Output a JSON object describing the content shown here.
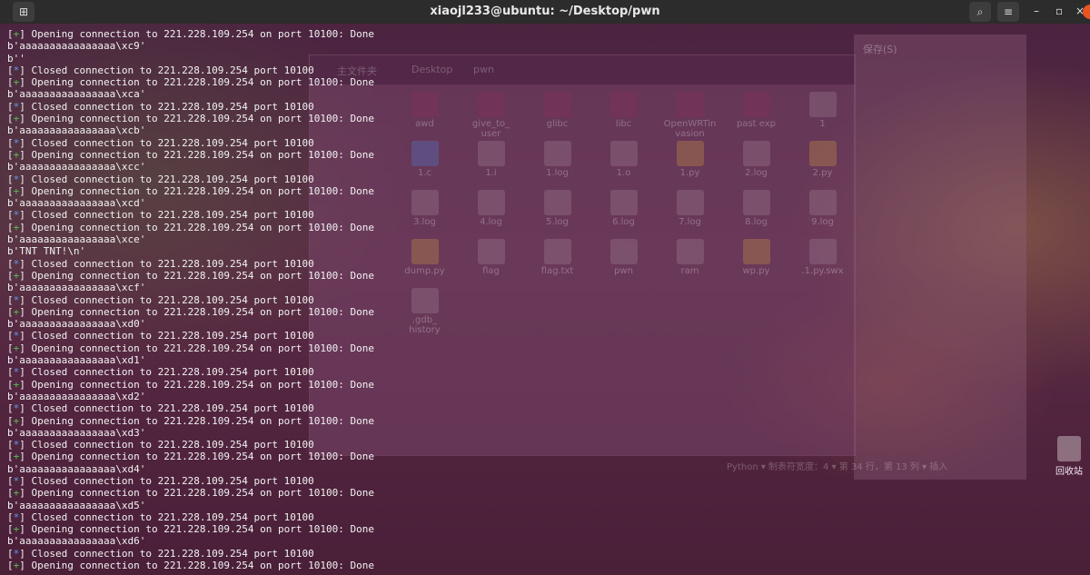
{
  "titlebar": {
    "title": "xiaojl233@ubuntu: ~/Desktop/pwn",
    "new_tab_icon": "new-tab-icon",
    "search_icon": "search-icon",
    "menu_icon": "hamburger-menu-icon",
    "minimize_label": "–",
    "maximize_label": "▫",
    "close_label": "×"
  },
  "file_manager": {
    "crumbs": [
      "主文件夹",
      "Desktop",
      "pwn"
    ],
    "items": [
      {
        "label": "awd",
        "kind": "folder"
      },
      {
        "label": "give_to_\nuser",
        "kind": "folder"
      },
      {
        "label": "glibc",
        "kind": "folder"
      },
      {
        "label": "libc",
        "kind": "folder"
      },
      {
        "label": "OpenWRTin\nvasion",
        "kind": "folder"
      },
      {
        "label": "past exp",
        "kind": "folder"
      },
      {
        "label": "1",
        "kind": "file"
      },
      {
        "label": "1.c",
        "kind": "c"
      },
      {
        "label": "1.i",
        "kind": "file"
      },
      {
        "label": "1.log",
        "kind": "file"
      },
      {
        "label": "1.o",
        "kind": "file"
      },
      {
        "label": "1.py",
        "kind": "py"
      },
      {
        "label": "2.log",
        "kind": "file"
      },
      {
        "label": "2.py",
        "kind": "py"
      },
      {
        "label": "3.log",
        "kind": "file"
      },
      {
        "label": "4.log",
        "kind": "file"
      },
      {
        "label": "5.log",
        "kind": "file"
      },
      {
        "label": "6.log",
        "kind": "file"
      },
      {
        "label": "7.log",
        "kind": "file"
      },
      {
        "label": "8.log",
        "kind": "file"
      },
      {
        "label": "9.log",
        "kind": "file"
      },
      {
        "label": "dump.py",
        "kind": "py"
      },
      {
        "label": "flag",
        "kind": "file"
      },
      {
        "label": "flag.txt",
        "kind": "file"
      },
      {
        "label": "pwn",
        "kind": "file"
      },
      {
        "label": "ram",
        "kind": "file"
      },
      {
        "label": "wp.py",
        "kind": "py"
      },
      {
        "label": ".1.py.swx",
        "kind": "file"
      },
      {
        "label": ".gdb_\nhistory",
        "kind": "file"
      }
    ]
  },
  "editor": {
    "title": "1.py",
    "save_label": "保存(S)",
    "status": "Python ▾   制表符宽度：4 ▾   第 34 行，第 13 列 ▾   插入"
  },
  "desktop": {
    "trash_label": "回收站"
  },
  "terminal": {
    "lines": [
      {
        "mark": "+",
        "text": "Opening connection to 221.228.109.254 on port 10100: Done"
      },
      {
        "mark": "",
        "text": "b'aaaaaaaaaaaaaaaa\\xc9'"
      },
      {
        "mark": "",
        "text": "b''"
      },
      {
        "mark": "*",
        "text": "Closed connection to 221.228.109.254 port 10100"
      },
      {
        "mark": "+",
        "text": "Opening connection to 221.228.109.254 on port 10100: Done"
      },
      {
        "mark": "",
        "text": "b'aaaaaaaaaaaaaaaa\\xca'"
      },
      {
        "mark": "*",
        "text": "Closed connection to 221.228.109.254 port 10100"
      },
      {
        "mark": "+",
        "text": "Opening connection to 221.228.109.254 on port 10100: Done"
      },
      {
        "mark": "",
        "text": "b'aaaaaaaaaaaaaaaa\\xcb'"
      },
      {
        "mark": "*",
        "text": "Closed connection to 221.228.109.254 port 10100"
      },
      {
        "mark": "+",
        "text": "Opening connection to 221.228.109.254 on port 10100: Done"
      },
      {
        "mark": "",
        "text": "b'aaaaaaaaaaaaaaaa\\xcc'"
      },
      {
        "mark": "*",
        "text": "Closed connection to 221.228.109.254 port 10100"
      },
      {
        "mark": "+",
        "text": "Opening connection to 221.228.109.254 on port 10100: Done"
      },
      {
        "mark": "",
        "text": "b'aaaaaaaaaaaaaaaa\\xcd'"
      },
      {
        "mark": "*",
        "text": "Closed connection to 221.228.109.254 port 10100"
      },
      {
        "mark": "+",
        "text": "Opening connection to 221.228.109.254 on port 10100: Done"
      },
      {
        "mark": "",
        "text": "b'aaaaaaaaaaaaaaaa\\xce'"
      },
      {
        "mark": "",
        "text": "b'TNT TNT!\\n'"
      },
      {
        "mark": "*",
        "text": "Closed connection to 221.228.109.254 port 10100"
      },
      {
        "mark": "+",
        "text": "Opening connection to 221.228.109.254 on port 10100: Done"
      },
      {
        "mark": "",
        "text": "b'aaaaaaaaaaaaaaaa\\xcf'"
      },
      {
        "mark": "*",
        "text": "Closed connection to 221.228.109.254 port 10100"
      },
      {
        "mark": "+",
        "text": "Opening connection to 221.228.109.254 on port 10100: Done"
      },
      {
        "mark": "",
        "text": "b'aaaaaaaaaaaaaaaa\\xd0'"
      },
      {
        "mark": "*",
        "text": "Closed connection to 221.228.109.254 port 10100"
      },
      {
        "mark": "+",
        "text": "Opening connection to 221.228.109.254 on port 10100: Done"
      },
      {
        "mark": "",
        "text": "b'aaaaaaaaaaaaaaaa\\xd1'"
      },
      {
        "mark": "*",
        "text": "Closed connection to 221.228.109.254 port 10100"
      },
      {
        "mark": "+",
        "text": "Opening connection to 221.228.109.254 on port 10100: Done"
      },
      {
        "mark": "",
        "text": "b'aaaaaaaaaaaaaaaa\\xd2'"
      },
      {
        "mark": "*",
        "text": "Closed connection to 221.228.109.254 port 10100"
      },
      {
        "mark": "+",
        "text": "Opening connection to 221.228.109.254 on port 10100: Done"
      },
      {
        "mark": "",
        "text": "b'aaaaaaaaaaaaaaaa\\xd3'"
      },
      {
        "mark": "*",
        "text": "Closed connection to 221.228.109.254 port 10100"
      },
      {
        "mark": "+",
        "text": "Opening connection to 221.228.109.254 on port 10100: Done"
      },
      {
        "mark": "",
        "text": "b'aaaaaaaaaaaaaaaa\\xd4'"
      },
      {
        "mark": "*",
        "text": "Closed connection to 221.228.109.254 port 10100"
      },
      {
        "mark": "+",
        "text": "Opening connection to 221.228.109.254 on port 10100: Done"
      },
      {
        "mark": "",
        "text": "b'aaaaaaaaaaaaaaaa\\xd5'"
      },
      {
        "mark": "*",
        "text": "Closed connection to 221.228.109.254 port 10100"
      },
      {
        "mark": "+",
        "text": "Opening connection to 221.228.109.254 on port 10100: Done"
      },
      {
        "mark": "",
        "text": "b'aaaaaaaaaaaaaaaa\\xd6'"
      },
      {
        "mark": "*",
        "text": "Closed connection to 221.228.109.254 port 10100"
      },
      {
        "mark": "+",
        "text": "Opening connection to 221.228.109.254 on port 10100: Done"
      }
    ]
  },
  "colors": {
    "plus_marker": "#4ec24e",
    "star_marker": "#5b9bf5",
    "terminal_text": "#f2f2f2",
    "titlebar_bg": "#2c2c2c",
    "accent_orange": "#e95420"
  }
}
